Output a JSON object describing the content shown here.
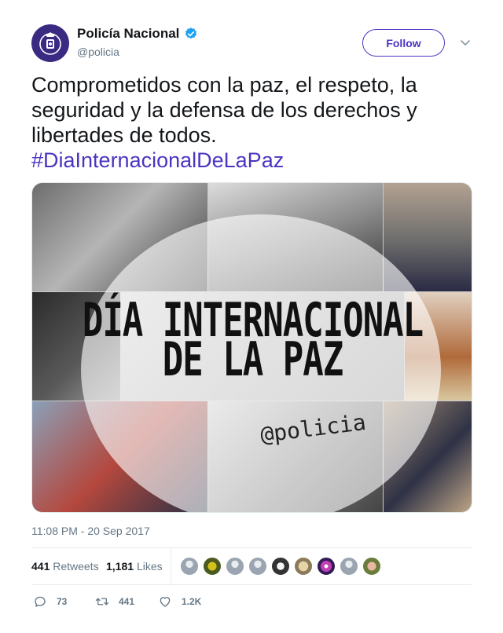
{
  "account": {
    "display_name": "Policía Nacional",
    "handle": "@policia",
    "verified_icon": "verified-badge-icon",
    "follow_label": "Follow"
  },
  "tweet": {
    "text": "Comprometidos con la paz, el respeto, la seguridad y la defensa de los derechos y libertades de todos.",
    "hashtag": "#DiaInternacionalDeLaPaz",
    "timestamp": "11:08 PM - 20 Sep 2017"
  },
  "media": {
    "title_line1": "DÍA INTERNACIONAL",
    "title_line2": "DE LA PAZ",
    "handle_text": "@policia"
  },
  "stats": {
    "retweets_count": "441",
    "retweets_label": "Retweets",
    "likes_count": "1,181",
    "likes_label": "Likes"
  },
  "actions": {
    "reply_count": "73",
    "retweet_count": "441",
    "like_count": "1.2K"
  },
  "colors": {
    "accent": "#4a35c2",
    "verified": "#1da1f2",
    "muted": "#657786"
  }
}
